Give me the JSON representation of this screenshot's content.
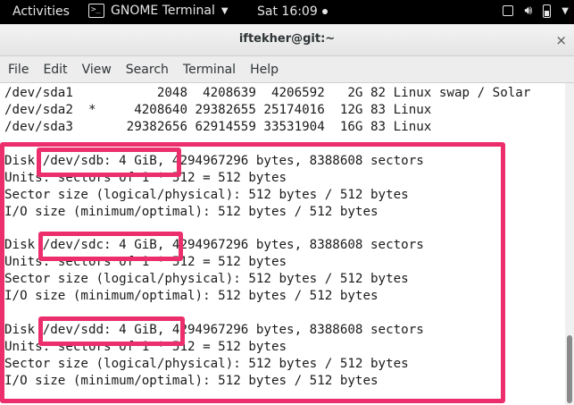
{
  "topbar": {
    "activities": "Activities",
    "app_name": "GNOME Terminal",
    "app_icon_text": ">_",
    "clock": "Sat 16:09",
    "icons": [
      "window-icon",
      "volume-icon",
      "battery-icon",
      "dropdown-icon"
    ]
  },
  "window": {
    "title": "iftekher@git:~",
    "close": "×"
  },
  "menu": [
    "File",
    "Edit",
    "View",
    "Search",
    "Terminal",
    "Help"
  ],
  "terminal": {
    "lines": [
      "/dev/sda1           2048  4208639  4206592   2G 82 Linux swap / Solar",
      "/dev/sda2  *     4208640 29382655 25174016  12G 83 Linux",
      "/dev/sda3       29382656 62914559 33531904  16G 83 Linux",
      "",
      "Disk /dev/sdb: 4 GiB, 4294967296 bytes, 8388608 sectors",
      "Units: sectors of 1 * 512 = 512 bytes",
      "Sector size (logical/physical): 512 bytes / 512 bytes",
      "I/O size (minimum/optimal): 512 bytes / 512 bytes",
      "",
      "Disk /dev/sdc: 4 GiB, 4294967296 bytes, 8388608 sectors",
      "Units: sectors of 1 * 512 = 512 bytes",
      "Sector size (logical/physical): 512 bytes / 512 bytes",
      "I/O size (minimum/optimal): 512 bytes / 512 bytes",
      "",
      "Disk /dev/sdd: 4 GiB, 4294967296 bytes, 8388608 sectors",
      "Units: sectors of 1 * 512 = 512 bytes",
      "Sector size (logical/physical): 512 bytes / 512 bytes",
      "I/O size (minimum/optimal): 512 bytes / 512 bytes"
    ]
  },
  "colors": {
    "highlight": "#ec2f6c",
    "topbar": "#000000"
  }
}
